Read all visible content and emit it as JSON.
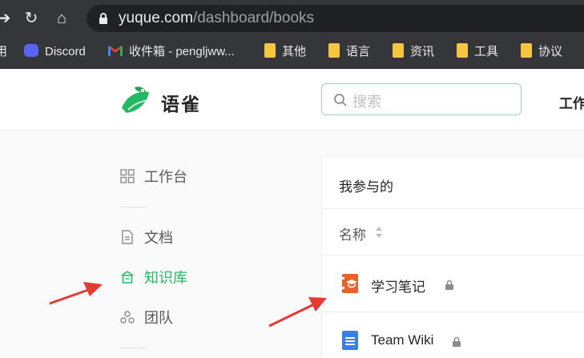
{
  "browser": {
    "url_domain": "yuque.com",
    "url_path": "/dashboard/books",
    "bookmarks": [
      {
        "label": "用"
      },
      {
        "label": "Discord"
      },
      {
        "label": "收件箱 - pengljww..."
      },
      {
        "label": "其他"
      },
      {
        "label": "语言"
      },
      {
        "label": "资讯"
      },
      {
        "label": "工具"
      },
      {
        "label": "协议"
      }
    ]
  },
  "header": {
    "logo_text": "语雀",
    "search_placeholder": "搜索",
    "nav_partial": "工作"
  },
  "sidebar": {
    "items": [
      {
        "label": "工作台"
      },
      {
        "label": "文档"
      },
      {
        "label": "知识库"
      },
      {
        "label": "团队"
      }
    ]
  },
  "main": {
    "section_title": "我参与的",
    "column_name": "名称",
    "books": [
      {
        "name": "学习笔记",
        "private": true
      },
      {
        "name": "Team Wiki",
        "private": true
      }
    ]
  },
  "colors": {
    "accent": "#25b864",
    "book_orange": "#e8612c",
    "book_blue": "#3a7ee8",
    "annotation_red": "#e53935"
  }
}
